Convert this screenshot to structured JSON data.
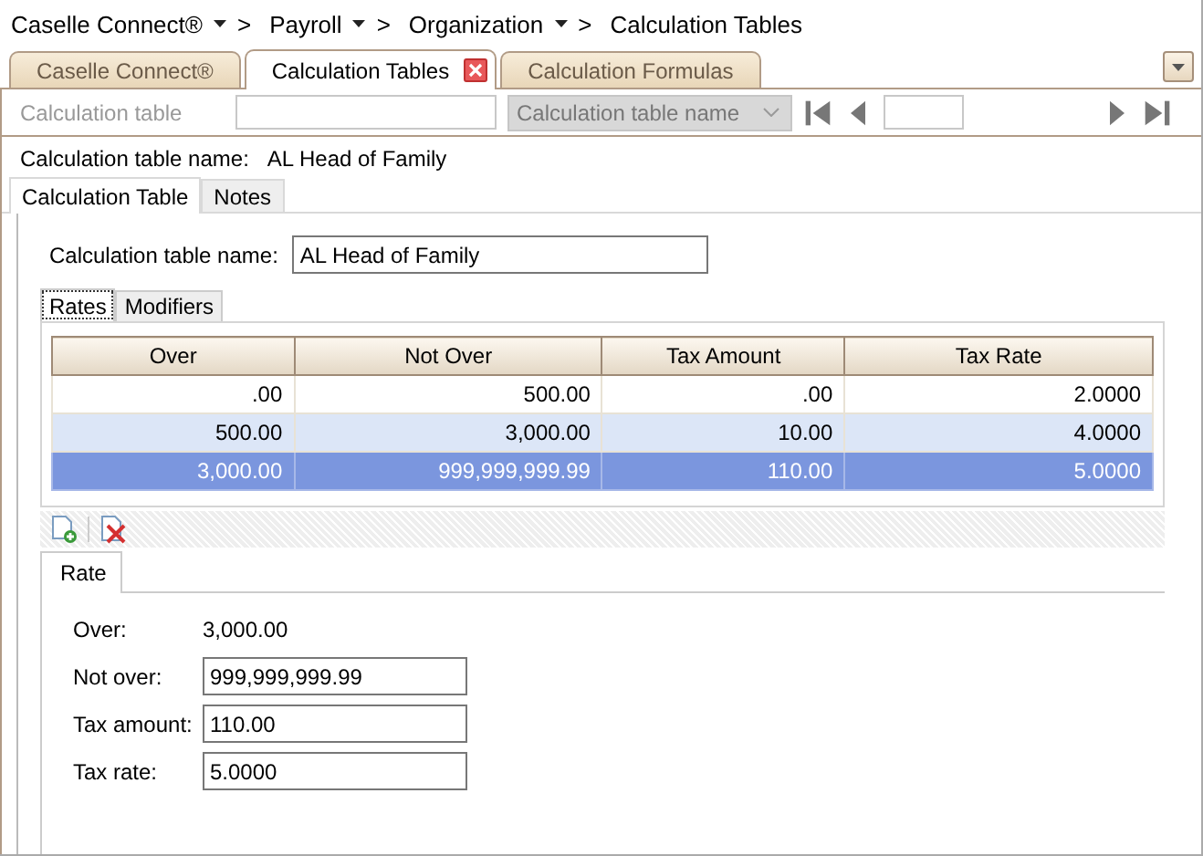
{
  "breadcrumb": [
    {
      "label": "Caselle Connect®",
      "has_menu": true
    },
    {
      "label": "Payroll",
      "has_menu": true
    },
    {
      "label": "Organization",
      "has_menu": true
    },
    {
      "label": "Calculation Tables",
      "has_menu": false
    }
  ],
  "breadcrumb_separator": ">",
  "document_tabs": [
    {
      "label": "Caselle Connect®",
      "selected": false,
      "closable": false
    },
    {
      "label": "Calculation Tables",
      "selected": true,
      "closable": true
    },
    {
      "label": "Calculation Formulas",
      "selected": false,
      "closable": false
    }
  ],
  "lookup": {
    "label": "Calculation table",
    "disabled": true,
    "name_placeholder": "Calculation table name"
  },
  "record": {
    "label": "Calculation table name:",
    "value": "AL Head of Family"
  },
  "tabs": [
    {
      "label": "Calculation Table",
      "selected": true
    },
    {
      "label": "Notes",
      "selected": false
    }
  ],
  "form": {
    "name_label": "Calculation table name:",
    "name_value": "AL Head of Family"
  },
  "sub_tabs": [
    {
      "label": "Rates",
      "selected": true
    },
    {
      "label": "Modifiers",
      "selected": false
    }
  ],
  "table": {
    "columns": [
      "Over",
      "Not Over",
      "Tax Amount",
      "Tax Rate"
    ],
    "rows": [
      {
        "cells": [
          ".00",
          "500.00",
          ".00",
          "2.0000"
        ],
        "alternate": false,
        "selected": false
      },
      {
        "cells": [
          "500.00",
          "3,000.00",
          "10.00",
          "4.0000"
        ],
        "alternate": true,
        "selected": false
      },
      {
        "cells": [
          "3,000.00",
          "999,999,999.99",
          "110.00",
          "5.0000"
        ],
        "alternate": false,
        "selected": true
      }
    ]
  },
  "detail": {
    "tab": "Rate",
    "fields": [
      {
        "label": "Over:",
        "value": "3,000.00",
        "kind": "text"
      },
      {
        "label": "Not over:",
        "value": "999,999,999.99",
        "kind": "input"
      },
      {
        "label": "Tax amount:",
        "value": "110.00",
        "kind": "input"
      },
      {
        "label": "Tax rate:",
        "value": "5.0000",
        "kind": "input"
      }
    ]
  }
}
